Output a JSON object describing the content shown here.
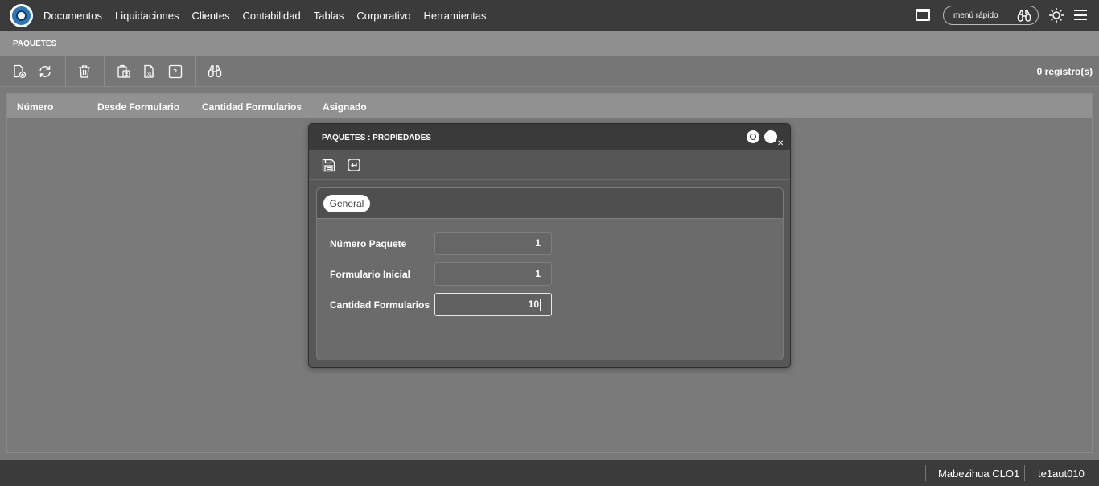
{
  "nav": {
    "items": [
      "Documentos",
      "Liquidaciones",
      "Clientes",
      "Contabilidad",
      "Tablas",
      "Corporativo",
      "Herramientas"
    ],
    "quick_menu_label": "menú rápido"
  },
  "page": {
    "title": "PAQUETES",
    "records": "0 registro(s)"
  },
  "grid": {
    "columns": [
      "Número",
      "Desde Formulario",
      "Cantidad Formularios",
      "Asignado"
    ]
  },
  "modal": {
    "title": "PAQUETES : PROPIEDADES",
    "tab": "General",
    "fields": [
      {
        "label": "Número Paquete",
        "value": "1"
      },
      {
        "label": "Formulario Inicial",
        "value": "1"
      },
      {
        "label": "Cantidad Formularios",
        "value": "10"
      }
    ]
  },
  "footer": {
    "user": "Mabezihua CLO1",
    "session": "te1aut010"
  }
}
